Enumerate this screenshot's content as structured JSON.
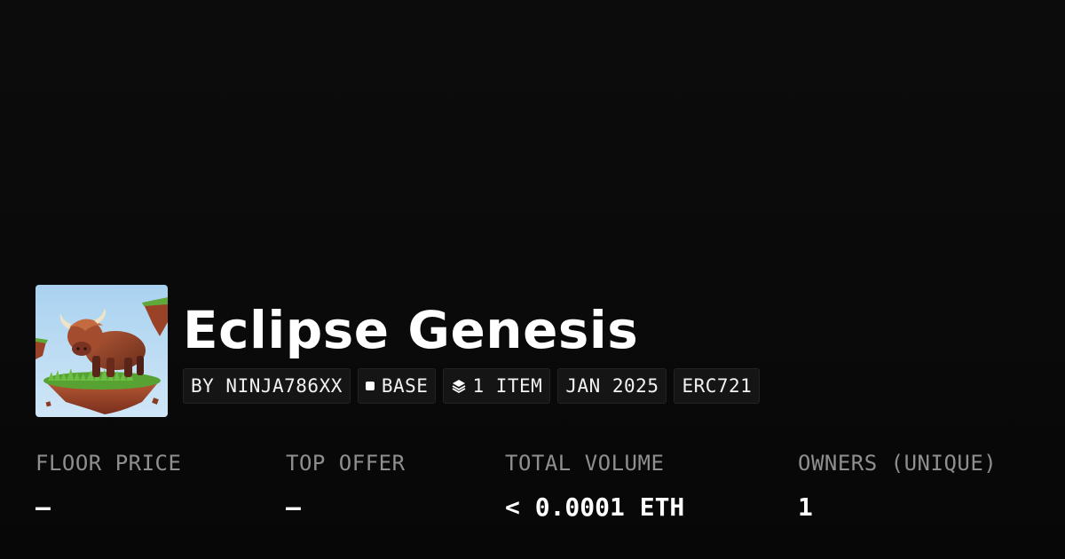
{
  "collection": {
    "title": "Eclipse Genesis",
    "avatar_icon": "highland-bull-on-floating-island-image"
  },
  "tags": {
    "creator": "BY NINJA786XX",
    "chain": "BASE",
    "chain_icon": "square-icon",
    "items": "1 ITEM",
    "items_icon": "layers-icon",
    "date": "JAN 2025",
    "standard": "ERC721"
  },
  "stats": {
    "floor_price": {
      "label": "FLOOR PRICE",
      "value": "–"
    },
    "top_offer": {
      "label": "TOP OFFER",
      "value": "–"
    },
    "total_volume": {
      "label": "TOTAL VOLUME",
      "value": "< 0.0001 ETH"
    },
    "owners": {
      "label": "OWNERS (UNIQUE)",
      "value": "1"
    }
  },
  "colors": {
    "background": "#0a0a0a",
    "text": "#ffffff",
    "label": "#8f8f8f",
    "tag_bg": "#151515"
  }
}
